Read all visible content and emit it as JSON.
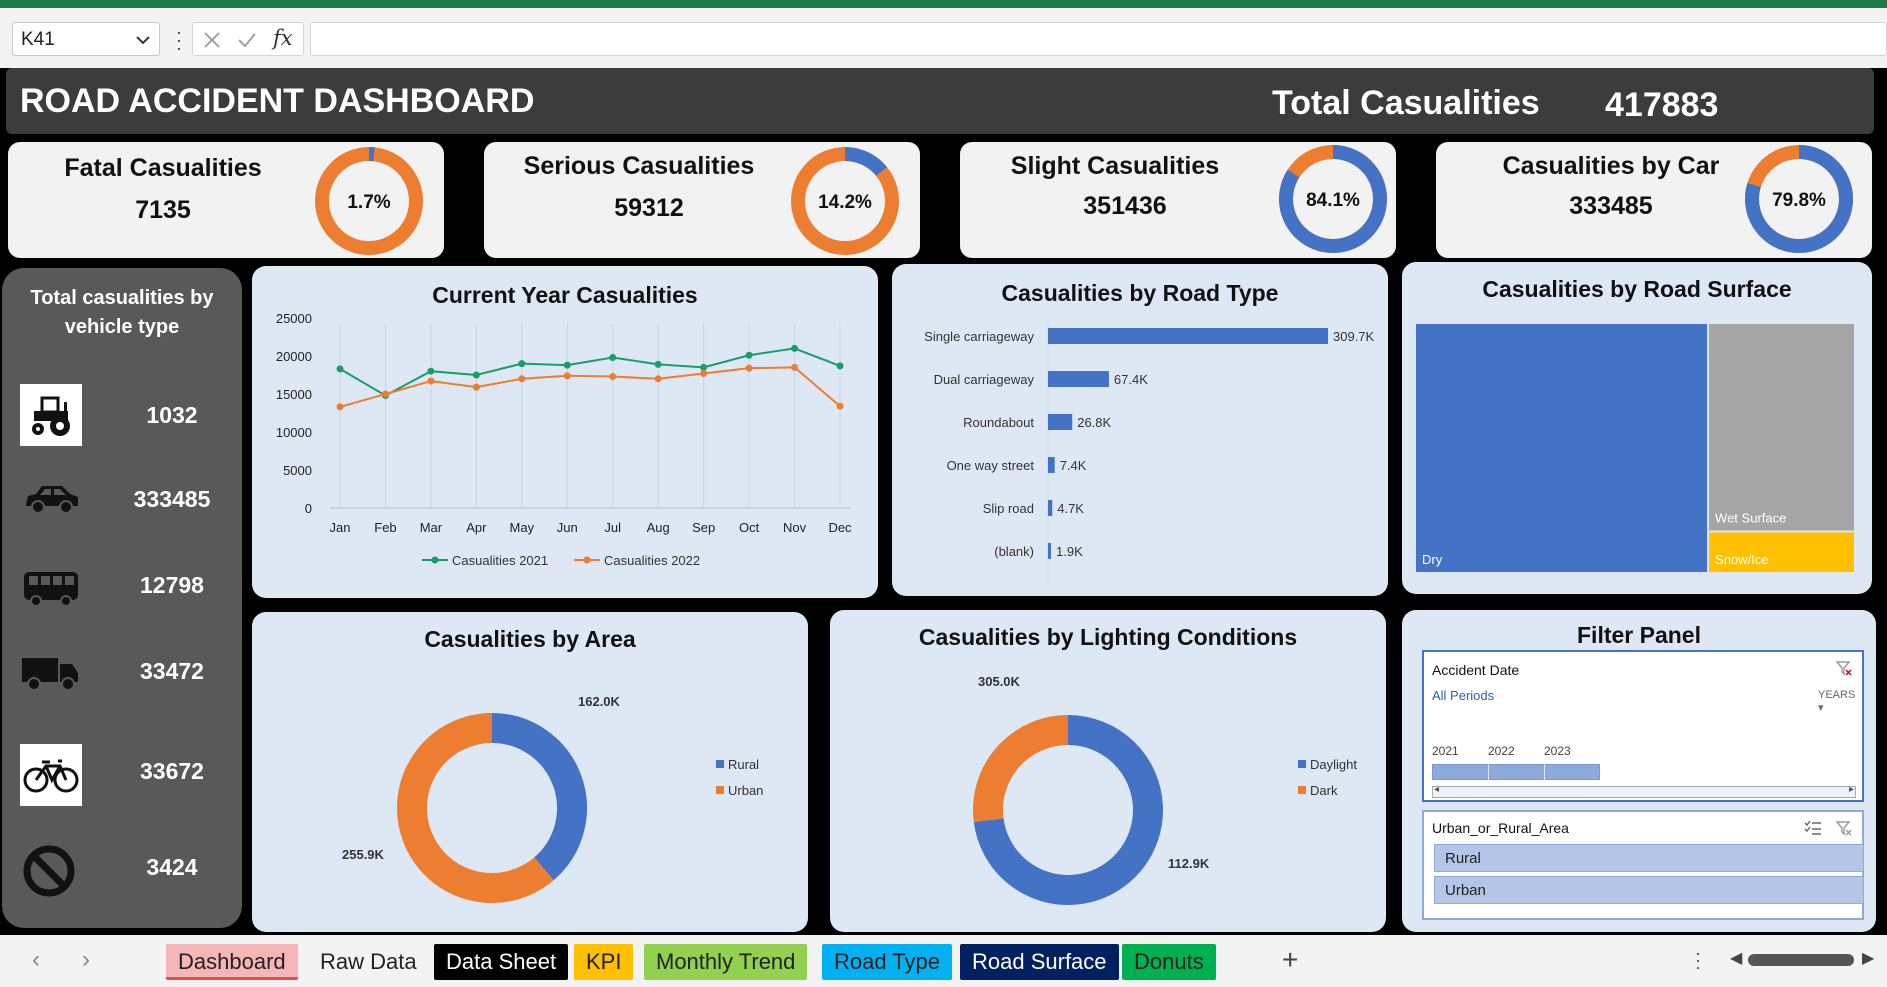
{
  "formula_bar": {
    "name_box": "K41",
    "fx_label": "fx"
  },
  "header": {
    "title": "ROAD ACCIDENT DASHBOARD",
    "total_label": "Total Casualities",
    "total_value": "417883"
  },
  "kpis": [
    {
      "label": "Fatal Casualities",
      "value": "7135",
      "pct_label": "1.7%",
      "pct": 1.7
    },
    {
      "label": "Serious Casualities",
      "value": "59312",
      "pct_label": "14.2%",
      "pct": 14.2
    },
    {
      "label": "Slight Casualities",
      "value": "351436",
      "pct_label": "84.1%",
      "pct": 84.1
    },
    {
      "label": "Casualities by Car",
      "value": "333485",
      "pct_label": "79.8%",
      "pct": 79.8
    }
  ],
  "colors": {
    "blue": "#4472c4",
    "orange": "#ed7d31",
    "green": "#1a9c6b",
    "gray": "#a5a5a5",
    "yellow": "#ffc000"
  },
  "vehicle_panel": {
    "title_line1": "Total casualities by",
    "title_line2": "vehicle type",
    "items": [
      {
        "icon": "tractor-icon",
        "value": "1032"
      },
      {
        "icon": "car-icon",
        "value": "333485"
      },
      {
        "icon": "bus-icon",
        "value": "12798"
      },
      {
        "icon": "truck-icon",
        "value": "33472"
      },
      {
        "icon": "bicycle-icon",
        "value": "33672"
      },
      {
        "icon": "no-entry-icon",
        "value": "3424"
      }
    ]
  },
  "panels": {
    "monthly": "Current Year Casualities",
    "road_type": "Casualities by Road Type",
    "road_surface": "Casualities by Road Surface",
    "area": "Casualities by Area",
    "lighting": "Casualities by Lighting Conditions",
    "filter": "Filter Panel"
  },
  "chart_data": [
    {
      "type": "line",
      "title": "Current Year Casualities",
      "categories": [
        "Jan",
        "Feb",
        "Mar",
        "Apr",
        "May",
        "Jun",
        "Jul",
        "Aug",
        "Sep",
        "Oct",
        "Nov",
        "Dec"
      ],
      "yticks": [
        "0",
        "5000",
        "10000",
        "15000",
        "20000",
        "25000"
      ],
      "ylim": [
        0,
        25000
      ],
      "series": [
        {
          "name": "Casualities 2021",
          "values": [
            18300,
            14800,
            18000,
            17500,
            19000,
            18800,
            19800,
            18900,
            18500,
            20100,
            21000,
            18700
          ]
        },
        {
          "name": "Casualities 2022",
          "values": [
            13300,
            15000,
            16700,
            15900,
            17000,
            17400,
            17300,
            17000,
            17700,
            18400,
            18500,
            13400
          ]
        }
      ],
      "legend": "bottom"
    },
    {
      "type": "bar",
      "title": "Casualities by Road Type",
      "categories": [
        "Single carriageway",
        "Dual carriageway",
        "Roundabout",
        "One way street",
        "Slip road",
        "(blank)"
      ],
      "values": [
        309.7,
        67.4,
        26.8,
        7.4,
        4.7,
        1.9
      ],
      "labels": [
        "309.7K",
        "67.4K",
        "26.8K",
        "7.4K",
        "4.7K",
        "1.9K"
      ]
    },
    {
      "type": "treemap",
      "title": "Casualities by Road Surface",
      "items": [
        {
          "name": "Dry",
          "value": 279
        },
        {
          "name": "Wet Surface",
          "value": 116
        },
        {
          "name": "Snow/Ice",
          "value": 22
        }
      ]
    },
    {
      "type": "pie",
      "title": "Casualities by Area",
      "series": [
        {
          "name": "Rural",
          "value": 162.0,
          "label": "162.0K"
        },
        {
          "name": "Urban",
          "value": 255.9,
          "label": "255.9K"
        }
      ],
      "legend": "right"
    },
    {
      "type": "pie",
      "title": "Casualities by Lighting Conditions",
      "series": [
        {
          "name": "Daylight",
          "value": 305.0,
          "label": "305.0K"
        },
        {
          "name": "Dark",
          "value": 112.9,
          "label": "112.9K"
        }
      ],
      "legend": "right"
    }
  ],
  "filters": {
    "timeline_title": "Accident Date",
    "all_periods": "All Periods",
    "years_label": "YEARS",
    "years": [
      "2021",
      "2022",
      "2023"
    ],
    "slicer_title": "Urban_or_Rural_Area",
    "slicer_items": [
      "Rural",
      "Urban"
    ]
  },
  "sheet_tabs": [
    {
      "label": "Dashboard",
      "bg": "#f4b6b6",
      "fg": "#222"
    },
    {
      "label": "Raw Data",
      "bg": "#f3f3f3",
      "fg": "#222"
    },
    {
      "label": "Data Sheet",
      "bg": "#000000",
      "fg": "#ffffff"
    },
    {
      "label": "KPI",
      "bg": "#ffc000",
      "fg": "#222"
    },
    {
      "label": "Monthly Trend",
      "bg": "#92d050",
      "fg": "#222"
    },
    {
      "label": "Road Type",
      "bg": "#00b0f0",
      "fg": "#222"
    },
    {
      "label": "Road Surface",
      "bg": "#002060",
      "fg": "#ffffff"
    },
    {
      "label": "Donuts",
      "bg": "#00b050",
      "fg": "#222"
    }
  ]
}
